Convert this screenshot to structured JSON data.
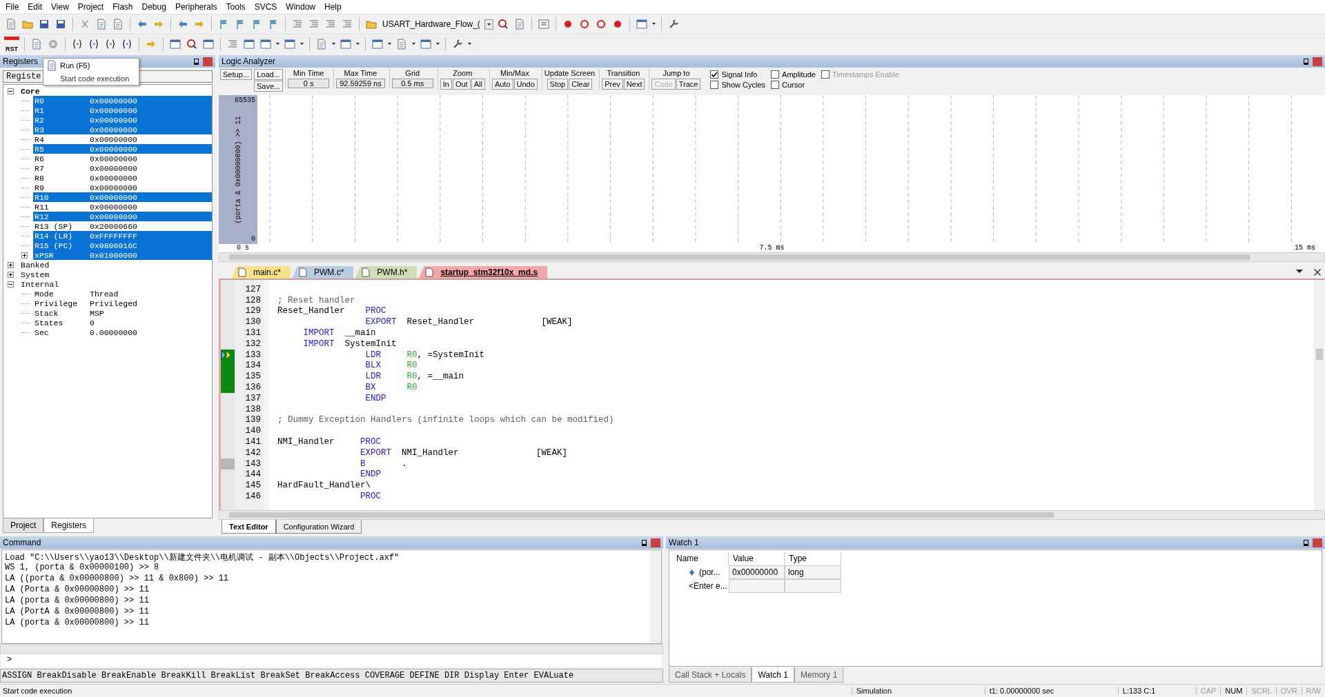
{
  "menu": [
    "File",
    "Edit",
    "View",
    "Project",
    "Flash",
    "Debug",
    "Peripherals",
    "Tools",
    "SVCS",
    "Window",
    "Help"
  ],
  "toolbar": {
    "target": "USART_Hardware_Flow_(",
    "reset_label": "RST"
  },
  "tooltip": {
    "title": "Run (F5)",
    "text": "Start code execution"
  },
  "registers": {
    "title": "Registers",
    "column": "Registe",
    "tree": [
      {
        "name": "Core",
        "expanded": true,
        "selected": true,
        "children": [
          {
            "name": "R0",
            "value": "0x00000000",
            "selected": true
          },
          {
            "name": "R1",
            "value": "0x00000000",
            "selected": true
          },
          {
            "name": "R2",
            "value": "0x00000000",
            "selected": true
          },
          {
            "name": "R3",
            "value": "0x00000000",
            "selected": true
          },
          {
            "name": "R4",
            "value": "0x00000000",
            "selected": false
          },
          {
            "name": "R5",
            "value": "0x00000000",
            "selected": true
          },
          {
            "name": "R6",
            "value": "0x00000000",
            "selected": false
          },
          {
            "name": "R7",
            "value": "0x00000000",
            "selected": false
          },
          {
            "name": "R8",
            "value": "0x00000000",
            "selected": false
          },
          {
            "name": "R9",
            "value": "0x00000000",
            "selected": false
          },
          {
            "name": "R10",
            "value": "0x00000000",
            "selected": true
          },
          {
            "name": "R11",
            "value": "0x00000000",
            "selected": false
          },
          {
            "name": "R12",
            "value": "0x00000000",
            "selected": true
          },
          {
            "name": "R13 (SP)",
            "value": "0x20000660",
            "selected": false
          },
          {
            "name": "R14 (LR)",
            "value": "0xFFFFFFFF",
            "selected": true
          },
          {
            "name": "R15 (PC)",
            "value": "0x0800016C",
            "selected": true
          },
          {
            "name": "xPSR",
            "value": "0x01000000",
            "selected": true,
            "expanded": false
          }
        ]
      },
      {
        "name": "Banked",
        "expanded": false,
        "selected": false
      },
      {
        "name": "System",
        "expanded": false,
        "selected": false
      },
      {
        "name": "Internal",
        "expanded": true,
        "selected": false,
        "children": [
          {
            "name": "Mode",
            "value": "Thread",
            "selected": false
          },
          {
            "name": "Privilege",
            "value": "Privileged",
            "selected": false
          },
          {
            "name": "Stack",
            "value": "MSP",
            "selected": false
          },
          {
            "name": "States",
            "value": "0",
            "selected": false
          },
          {
            "name": "Sec",
            "value": "0.00000000",
            "selected": false
          }
        ]
      }
    ],
    "tabs": [
      {
        "label": "Project",
        "selected": false
      },
      {
        "label": "Registers",
        "selected": true
      }
    ]
  },
  "logic_analyzer": {
    "title": "Logic Analyzer",
    "setup": "Setup...",
    "load": "Load...",
    "save": "Save...",
    "fields": [
      {
        "label": "Min Time",
        "value": "0 s"
      },
      {
        "label": "Max Time",
        "value": "92.59259 ns"
      },
      {
        "label": "Grid",
        "value": "0.5 ms"
      }
    ],
    "button_groups": [
      {
        "label": "Zoom",
        "buttons": [
          {
            "label": "In",
            "disabled": false
          },
          {
            "label": "Out",
            "disabled": false
          },
          {
            "label": "All",
            "disabled": false
          }
        ]
      },
      {
        "label": "Min/Max",
        "buttons": [
          {
            "label": "Auto",
            "disabled": false
          },
          {
            "label": "Undo",
            "disabled": false
          }
        ]
      },
      {
        "label": "Update Screen",
        "buttons": [
          {
            "label": "Stop",
            "disabled": false
          },
          {
            "label": "Clear",
            "disabled": false
          }
        ]
      },
      {
        "label": "Transition",
        "buttons": [
          {
            "label": "Prev",
            "disabled": false
          },
          {
            "label": "Next",
            "disabled": false
          }
        ]
      },
      {
        "label": "Jump to",
        "buttons": [
          {
            "label": "Code",
            "disabled": true
          },
          {
            "label": "Trace",
            "disabled": false
          }
        ]
      }
    ],
    "options": [
      {
        "label": "Signal Info",
        "checked": true,
        "disabled": false
      },
      {
        "label": "Show Cycles",
        "checked": false,
        "disabled": false
      },
      {
        "label": "Amplitude",
        "checked": false,
        "disabled": false
      },
      {
        "label": "Cursor",
        "checked": false,
        "disabled": false
      },
      {
        "label": "Timestamps Enable",
        "checked": false,
        "disabled": true
      }
    ],
    "signal": "(porta & 0x00000800) >> 11",
    "y_max": "65535",
    "y_min": "0",
    "time_labels": [
      "0 s",
      "7.5 ms",
      "15 ms"
    ]
  },
  "editor": {
    "tabs": [
      {
        "label": "main.c*",
        "selected": false,
        "color": "#f9e08a"
      },
      {
        "label": "PWM.c*",
        "selected": false,
        "color": "#b7cde3"
      },
      {
        "label": "PWM.h*",
        "selected": false,
        "color": "#cfdcb4"
      },
      {
        "label": "startup_stm32f10x_md.s",
        "selected": true,
        "color": "#f2a6a6"
      }
    ],
    "lines": [
      {
        "num": "127",
        "current": false
      },
      {
        "num": "128",
        "current": false,
        "tokens": [
          {
            "kind": "comment",
            "text": "; Reset handler"
          }
        ]
      },
      {
        "num": "129",
        "current": false,
        "tokens": [
          {
            "kind": "plain",
            "text": "Reset_Handler    "
          },
          {
            "kind": "keyword",
            "text": "PROC"
          }
        ]
      },
      {
        "num": "130",
        "current": false,
        "tokens": [
          {
            "kind": "keyword",
            "text": "                 EXPORT"
          },
          {
            "kind": "plain",
            "text": "  Reset_Handler             [WEAK]"
          }
        ]
      },
      {
        "num": "131",
        "current": false,
        "tokens": [
          {
            "kind": "keyword",
            "text": "     IMPORT"
          },
          {
            "kind": "plain",
            "text": "  __main"
          }
        ]
      },
      {
        "num": "132",
        "current": false,
        "tokens": [
          {
            "kind": "keyword",
            "text": "     IMPORT"
          },
          {
            "kind": "plain",
            "text": "  SystemInit"
          }
        ]
      },
      {
        "num": "133",
        "current": true,
        "executed": true,
        "tokens": [
          {
            "kind": "keyword",
            "text": "                 LDR"
          },
          {
            "kind": "register",
            "text": "     R0"
          },
          {
            "kind": "plain",
            "text": ", =SystemInit"
          }
        ]
      },
      {
        "num": "134",
        "current": false,
        "executed": true,
        "tokens": [
          {
            "kind": "keyword",
            "text": "                 BLX"
          },
          {
            "kind": "register",
            "text": "     R0"
          }
        ]
      },
      {
        "num": "135",
        "current": false,
        "executed": true,
        "tokens": [
          {
            "kind": "keyword",
            "text": "                 LDR"
          },
          {
            "kind": "register",
            "text": "     R0"
          },
          {
            "kind": "plain",
            "text": ", =__main"
          }
        ]
      },
      {
        "num": "136",
        "current": false,
        "executed": true,
        "tokens": [
          {
            "kind": "keyword",
            "text": "                 BX"
          },
          {
            "kind": "register",
            "text": "      R0"
          }
        ]
      },
      {
        "num": "137",
        "current": false,
        "tokens": [
          {
            "kind": "keyword",
            "text": "                 ENDP"
          }
        ]
      },
      {
        "num": "138",
        "current": false
      },
      {
        "num": "139",
        "current": false,
        "tokens": [
          {
            "kind": "comment",
            "text": "; Dummy Exception Handlers (infinite loops which can be modified)"
          }
        ]
      },
      {
        "num": "140",
        "current": false
      },
      {
        "num": "141",
        "current": false,
        "tokens": [
          {
            "kind": "plain",
            "text": "NMI_Handler     "
          },
          {
            "kind": "keyword",
            "text": "PROC"
          }
        ]
      },
      {
        "num": "142",
        "current": false,
        "tokens": [
          {
            "kind": "keyword",
            "text": "                EXPORT"
          },
          {
            "kind": "plain",
            "text": "  NMI_Handler               [WEAK]"
          }
        ]
      },
      {
        "num": "143",
        "current": false,
        "executed": false,
        "tokens": [
          {
            "kind": "keyword",
            "text": "                B"
          },
          {
            "kind": "plain",
            "text": "       ."
          }
        ]
      },
      {
        "num": "144",
        "current": false,
        "tokens": [
          {
            "kind": "keyword",
            "text": "                ENDP"
          }
        ]
      },
      {
        "num": "145",
        "current": false,
        "tokens": [
          {
            "kind": "plain",
            "text": "HardFault_Handler\\"
          }
        ]
      },
      {
        "num": "146",
        "current": false,
        "tokens": [
          {
            "kind": "keyword",
            "text": "                PROC"
          }
        ]
      }
    ],
    "bottom_tabs": [
      {
        "label": "Text Editor",
        "selected": true
      },
      {
        "label": "Configuration Wizard",
        "selected": false
      }
    ]
  },
  "command": {
    "title": "Command",
    "lines": [
      "Load \"C:\\\\Users\\\\yao13\\\\Desktop\\\\新建文件夹\\\\电机调试 - 副本\\\\Objects\\\\Project.axf\"",
      "WS 1, (porta & 0x00000100) >> 8",
      "LA ((porta & 0x00000800) >> 11 & 0x800) >> 11",
      "LA (Porta & 0x00000800) >> 11",
      "LA (porta & 0x00000800) >> 11",
      "LA (PortA & 0x00000800) >> 11",
      "LA (porta & 0x00000800) >> 11"
    ],
    "prompt": ">",
    "hints": "ASSIGN BreakDisable BreakEnable BreakKill BreakList BreakSet BreakAccess COVERAGE DEFINE DIR Display Enter EVALuate"
  },
  "watch": {
    "title": "Watch 1",
    "columns": [
      "Name",
      "Value",
      "Type"
    ],
    "rows": [
      {
        "name": "(por...",
        "value": "0x00000000",
        "type": "long"
      },
      {
        "name": "<Enter e..."
      }
    ],
    "tabs": [
      {
        "label": "Call Stack + Locals",
        "selected": false
      },
      {
        "label": "Watch 1",
        "selected": true
      },
      {
        "label": "Memory 1",
        "selected": false
      }
    ]
  },
  "status_bar": {
    "message": "Start code execution",
    "mode": "Simulation",
    "time": "t1: 0.00000000 sec",
    "position": "L:133 C:1",
    "indicators": [
      {
        "label": "CAP",
        "on": false
      },
      {
        "label": "NUM",
        "on": true
      },
      {
        "label": "SCRL",
        "on": false
      },
      {
        "label": "OVR",
        "on": false
      },
      {
        "label": "R/W",
        "on": false
      }
    ]
  }
}
